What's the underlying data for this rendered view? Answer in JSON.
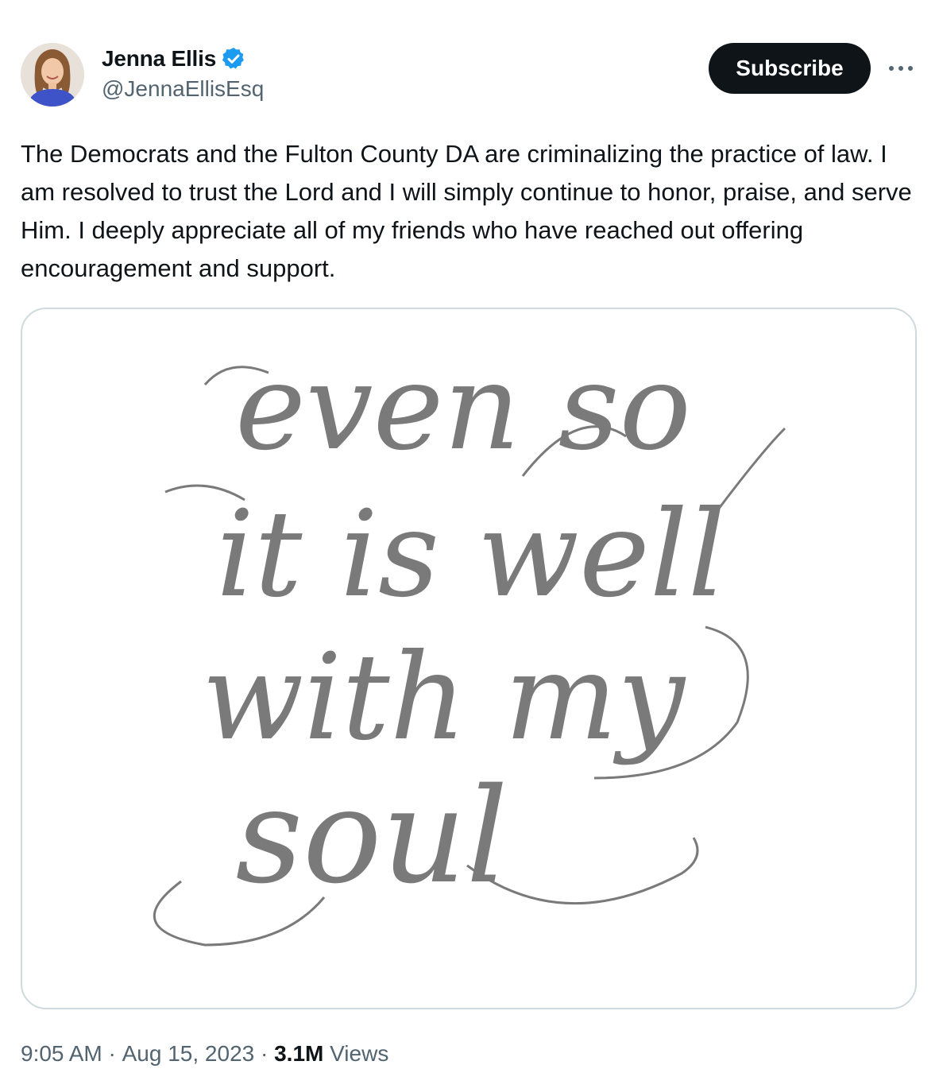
{
  "author": {
    "display_name": "Jenna Ellis",
    "handle": "@JennaEllisEsq",
    "verified_icon": "verified-badge-icon",
    "verified_color": "#1d9bf0"
  },
  "actions": {
    "subscribe_label": "Subscribe",
    "more_icon": "more-options-icon"
  },
  "tweet": {
    "text": "The Democrats and the Fulton County DA are criminalizing the practice of law. I am resolved to trust the Lord and I will simply continue to honor, praise, and serve Him. I deeply appreciate all of my friends who have reached out offering encouragement and support."
  },
  "media": {
    "lines": [
      "even so",
      "it is well",
      "with my",
      "soul"
    ],
    "ink_color": "#7a7a7a"
  },
  "meta": {
    "time": "9:05 AM",
    "separator": " · ",
    "date": "Aug 15, 2023",
    "views_count": "3.1M",
    "views_label": " Views"
  }
}
